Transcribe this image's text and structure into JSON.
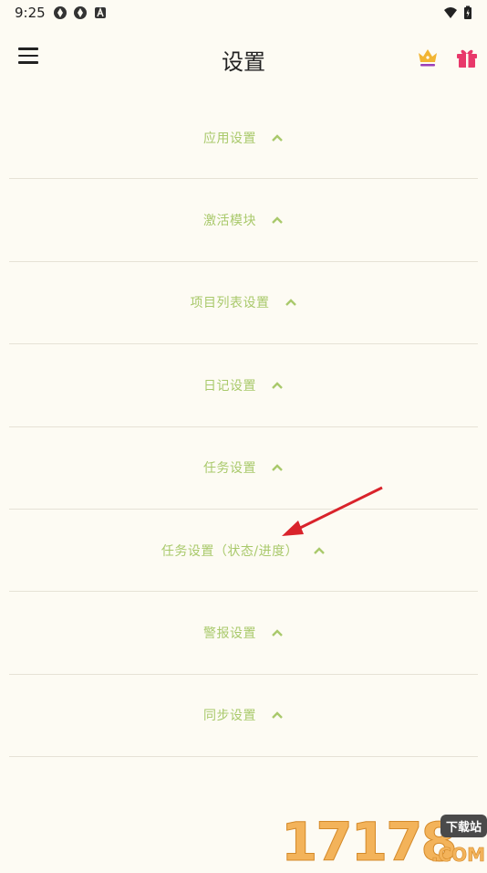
{
  "status": {
    "time": "9:25"
  },
  "header": {
    "title": "设置"
  },
  "settings": {
    "items": [
      {
        "label": "应用设置"
      },
      {
        "label": "激活模块"
      },
      {
        "label": "项目列表设置"
      },
      {
        "label": "日记设置"
      },
      {
        "label": "任务设置"
      },
      {
        "label": "任务设置（状态/进度）"
      },
      {
        "label": "警报设置"
      },
      {
        "label": "同步设置"
      }
    ]
  },
  "watermark": {
    "digits": "17178",
    "badge": "下载站",
    "suffix": ".COM"
  },
  "colors": {
    "accent": "#a9c96b",
    "background": "#fdfbf3",
    "arrow": "#d9232b",
    "gift": "#e8386a",
    "crown": "#f2b533"
  },
  "icons": [
    "menu-icon",
    "crown-icon",
    "gift-icon",
    "chevron-up-icon",
    "wifi-icon",
    "battery-icon"
  ]
}
